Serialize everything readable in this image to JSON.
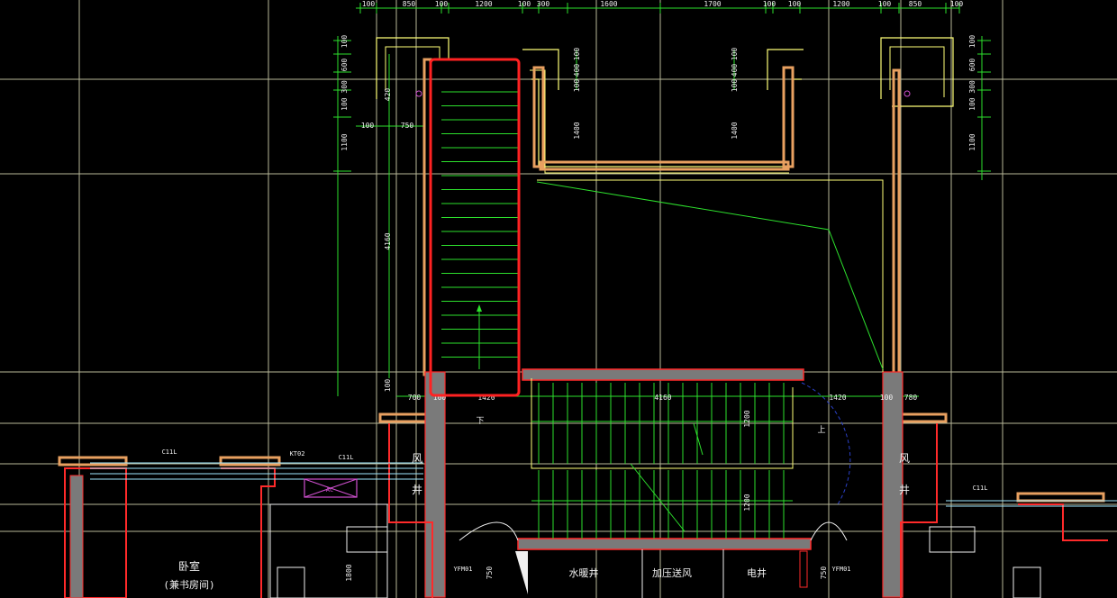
{
  "colors": {
    "background": "#000000",
    "grid": "#d8d8b4",
    "dimension": "#2de02d",
    "wall": "#ffff78",
    "hatch": "#e8a060",
    "red": "#ff2a2a",
    "concrete": "#7a7a7a",
    "cyan": "#9fe8ff",
    "magenta": "#d050d0",
    "blue": "#2a40c8",
    "white": "#f0f0f0",
    "selection": "#ff2222"
  },
  "top_dims": [
    "100",
    "850",
    "100",
    "1200",
    "100",
    "300",
    "1600",
    "1700",
    "100",
    "100",
    "1200",
    "100",
    "850",
    "100"
  ],
  "left_dims": [
    "100",
    "600",
    "100 300",
    "420",
    "1100",
    "4160",
    "100"
  ],
  "right_dims": [
    "100",
    "600",
    "100 300",
    "1100"
  ],
  "inner_dims_left": [
    "100",
    "400",
    "100",
    "1400"
  ],
  "inner_dims_right": [
    "100",
    "400",
    "100",
    "1400"
  ],
  "side_marks": {
    "d100": "100",
    "d750": "750"
  },
  "mid_dims": [
    "700",
    "100",
    "1420",
    "4160",
    "1420",
    "100",
    "780"
  ],
  "stair_dims": [
    "1200",
    "1200"
  ],
  "bottom_dims": [
    "1800",
    "750",
    "750"
  ],
  "labels": {
    "shaft_left_1": "风",
    "shaft_left_2": "井",
    "shaft_right_1": "风",
    "shaft_right_2": "井",
    "bedroom": "卧室",
    "bedroom_sub": "(兼书房间)",
    "water_shaft": "水暖井",
    "pressure_shaft": "加压送风",
    "elec_shaft": "电井",
    "ac": "AC",
    "kt02": "KT02",
    "c1l_1": "C11L",
    "c1l_2": "C11L",
    "c1l_3": "C11L",
    "door_left": "YFM01",
    "door_right": "YFM01",
    "down_arrow": "下",
    "up_arrow": "上"
  }
}
